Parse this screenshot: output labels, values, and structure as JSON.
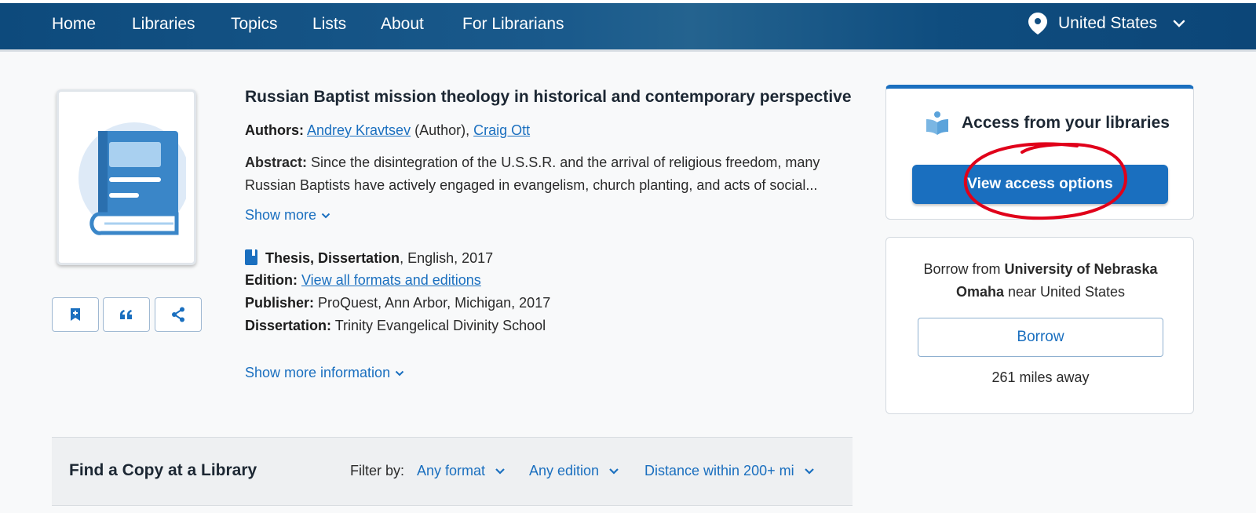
{
  "nav": {
    "items": [
      "Home",
      "Libraries",
      "Topics",
      "Lists",
      "About",
      "For Librarians"
    ],
    "location": "United States"
  },
  "record": {
    "title": "Russian Baptist mission theology in historical and contemporary perspective",
    "authors_label": "Authors:",
    "author1": "Andrey Kravtsev",
    "author1_role": " (Author), ",
    "author2": "Craig Ott",
    "abstract_label": "Abstract:",
    "abstract_line1": "Since the disintegration of the U.S.S.R. and the arrival of religious freedom, many",
    "abstract_line2": "Russian Baptists have actively engaged in evangelism, church planting, and acts of social...",
    "show_more": "Show more",
    "format_bold": "Thesis, Dissertation",
    "format_rest": ", English, 2017",
    "edition_label": "Edition:",
    "edition_link": "View all formats and editions",
    "publisher_label": "Publisher:",
    "publisher": "ProQuest, Ann Arbor, Michigan, 2017",
    "dissertation_label": "Dissertation:",
    "dissertation": "Trinity Evangelical Divinity School",
    "show_more_info": "Show more information"
  },
  "access": {
    "heading": "Access from your libraries",
    "button": "View access options"
  },
  "borrow": {
    "prefix": "Borrow from ",
    "library_line1": "University of Nebraska",
    "library_line2": "Omaha",
    "suffix": " near United States",
    "button": "Borrow",
    "distance": "261 miles away"
  },
  "find": {
    "title": "Find a Copy at a Library",
    "filter_label": "Filter by:",
    "filters": [
      "Any format",
      "Any edition",
      "Distance within 200+ mi"
    ]
  },
  "colors": {
    "accent": "#1a6fbf",
    "nav_bg": "#0d4a7c",
    "annotation": "#e0001a"
  }
}
